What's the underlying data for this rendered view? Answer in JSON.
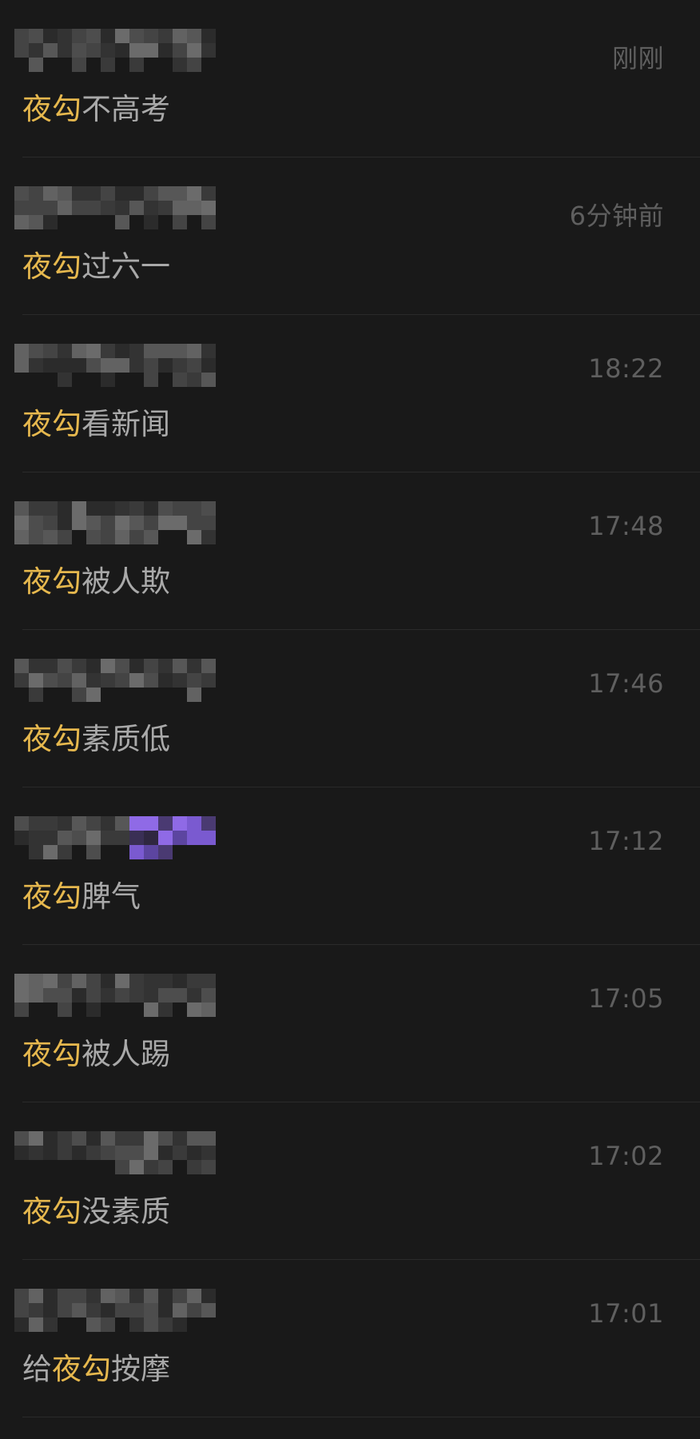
{
  "colors": {
    "background": "#191919",
    "divider": "#2a2a2a",
    "highlight": "#e6b84e",
    "message_text": "#a9a9a9",
    "time_text": "#5f5f5f"
  },
  "conversations": [
    {
      "time": "刚刚",
      "message": [
        {
          "text": "夜勾",
          "highlight": true
        },
        {
          "text": "不高考",
          "highlight": false
        }
      ]
    },
    {
      "time": "6分钟前",
      "message": [
        {
          "text": "夜勾",
          "highlight": true
        },
        {
          "text": "过六一",
          "highlight": false
        }
      ]
    },
    {
      "time": "18:22",
      "message": [
        {
          "text": "夜勾",
          "highlight": true
        },
        {
          "text": "看新闻",
          "highlight": false
        }
      ]
    },
    {
      "time": "17:48",
      "message": [
        {
          "text": "夜勾",
          "highlight": true
        },
        {
          "text": "被人欺",
          "highlight": false
        }
      ]
    },
    {
      "time": "17:46",
      "message": [
        {
          "text": "夜勾",
          "highlight": true
        },
        {
          "text": "素质低",
          "highlight": false
        }
      ]
    },
    {
      "time": "17:12",
      "message": [
        {
          "text": "夜勾",
          "highlight": true
        },
        {
          "text": "脾气",
          "highlight": false
        }
      ]
    },
    {
      "time": "17:05",
      "message": [
        {
          "text": "夜勾",
          "highlight": true
        },
        {
          "text": "被人踢",
          "highlight": false
        }
      ]
    },
    {
      "time": "17:02",
      "message": [
        {
          "text": "夜勾",
          "highlight": true
        },
        {
          "text": "没素质",
          "highlight": false
        }
      ]
    },
    {
      "time": "17:01",
      "message": [
        {
          "text": "给",
          "highlight": false
        },
        {
          "text": "夜勾",
          "highlight": true
        },
        {
          "text": "按摩",
          "highlight": false
        }
      ]
    }
  ]
}
